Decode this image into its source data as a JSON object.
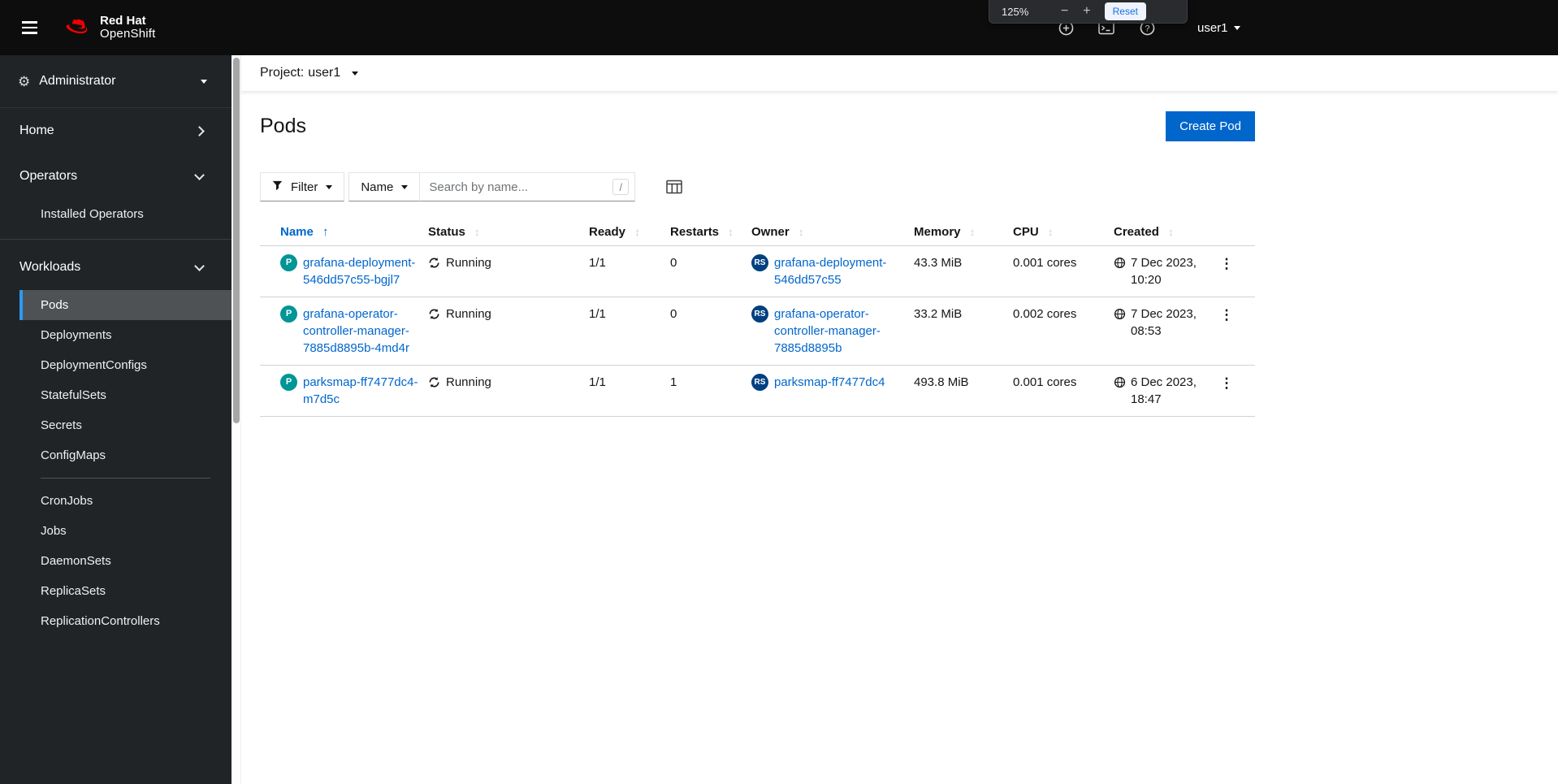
{
  "colors": {
    "accent": "#0066cc",
    "masthead_bg": "#0d0d0d",
    "sidebar_bg": "#212427",
    "nav_selected_bg": "#4f5255",
    "nav_selected_border": "#2b9af3",
    "pod_badge_bg": "#009596",
    "replicaset_badge_bg": "#004080",
    "link": "#0066cc",
    "brand_red": "#ee0000"
  },
  "zoom_popup": {
    "level": "125%",
    "minus_label": "−",
    "plus_label": "+",
    "reset_label": "Reset"
  },
  "masthead": {
    "brand_line1": "Red Hat",
    "brand_line2": "OpenShift",
    "username": "user1"
  },
  "sidebar": {
    "perspective": {
      "label": "Administrator"
    },
    "home": {
      "label": "Home"
    },
    "operators": {
      "label": "Operators",
      "items": [
        {
          "label": "Installed Operators"
        }
      ]
    },
    "workloads": {
      "label": "Workloads",
      "items": [
        {
          "label": "Pods",
          "active": true
        },
        {
          "label": "Deployments"
        },
        {
          "label": "DeploymentConfigs"
        },
        {
          "label": "StatefulSets"
        },
        {
          "label": "Secrets"
        },
        {
          "label": "ConfigMaps"
        },
        {
          "label": "CronJobs"
        },
        {
          "label": "Jobs"
        },
        {
          "label": "DaemonSets"
        },
        {
          "label": "ReplicaSets"
        },
        {
          "label": "ReplicationControllers"
        }
      ]
    }
  },
  "project_bar": {
    "label": "Project:",
    "value": "user1"
  },
  "page": {
    "title": "Pods",
    "create_button_label": "Create Pod"
  },
  "toolbar": {
    "filter_label": "Filter",
    "attribute_label": "Name",
    "search_placeholder": "Search by name...",
    "search_shortcut": "/"
  },
  "icons": {
    "sort_ascending": "↑",
    "sort_none": "↕",
    "kebab": "⋮",
    "gear": "⚙"
  },
  "table": {
    "columns": [
      "Name",
      "Status",
      "Ready",
      "Restarts",
      "Owner",
      "Memory",
      "CPU",
      "Created"
    ],
    "pod_badge": "P",
    "owner_badge": "RS",
    "rows": [
      {
        "name": "grafana-deployment-546dd57c55-bgjl7",
        "status": "Running",
        "ready": "1/1",
        "restarts": "0",
        "owner": "grafana-deployment-546dd57c55",
        "memory": "43.3 MiB",
        "cpu": "0.001 cores",
        "created": "7 Dec 2023, 10:20"
      },
      {
        "name": "grafana-operator-controller-manager-7885d8895b-4md4r",
        "status": "Running",
        "ready": "1/1",
        "restarts": "0",
        "owner": "grafana-operator-controller-manager-7885d8895b",
        "memory": "33.2 MiB",
        "cpu": "0.002 cores",
        "created": "7 Dec 2023, 08:53"
      },
      {
        "name": "parksmap-ff7477dc4-m7d5c",
        "status": "Running",
        "ready": "1/1",
        "restarts": "1",
        "owner": "parksmap-ff7477dc4",
        "memory": "493.8 MiB",
        "cpu": "0.001 cores",
        "created": "6 Dec 2023, 18:47"
      }
    ]
  }
}
